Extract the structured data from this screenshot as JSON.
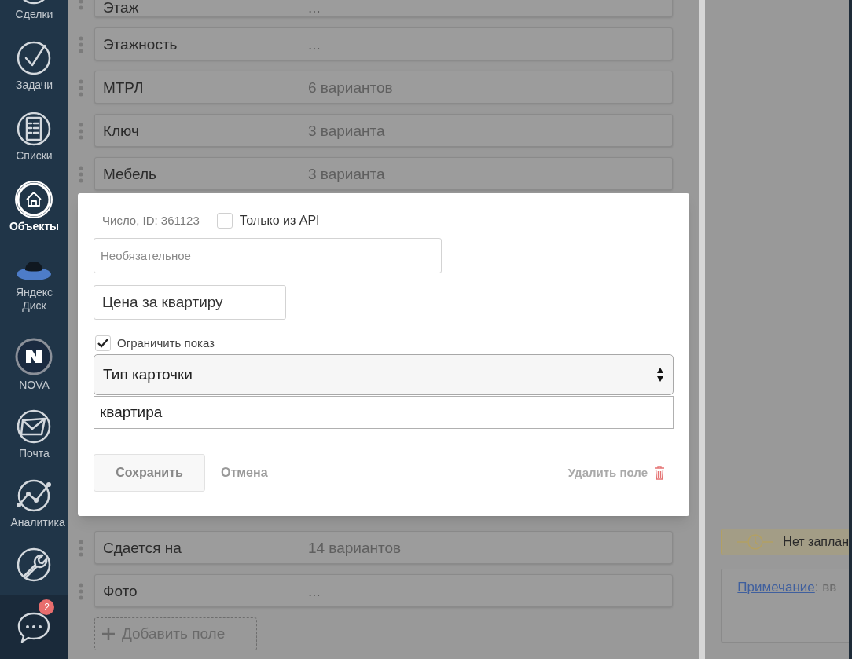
{
  "sidebar": {
    "items": [
      {
        "label": "Сделки",
        "selected": false
      },
      {
        "label": "Задачи",
        "selected": false
      },
      {
        "label": "Списки",
        "selected": false
      },
      {
        "label": "Объекты",
        "selected": true
      },
      {
        "label": "Яндекс Диск",
        "selected": false
      },
      {
        "label": "NOVA",
        "selected": false
      },
      {
        "label": "Почта",
        "selected": false
      },
      {
        "label": "Аналитика",
        "selected": false
      },
      {
        "selected": false
      }
    ],
    "chat": {
      "badge": "2"
    }
  },
  "fields_top": [
    {
      "name": "Этаж",
      "value": "..."
    },
    {
      "name": "Этажность",
      "value": "..."
    },
    {
      "name": "МТРЛ",
      "value": "6 вариантов"
    },
    {
      "name": "Ключ",
      "value": "3 варианта"
    },
    {
      "name": "Мебель",
      "value": "3 варианта"
    }
  ],
  "fields_bottom": [
    {
      "name": "Сдается на",
      "value": "14 вариантов"
    },
    {
      "name": "Фото",
      "value": "..."
    }
  ],
  "add_field": "Добавить поле",
  "dialog": {
    "type_label": "Число, ID: 361123",
    "api_only": {
      "label": "Только из API",
      "checked": false
    },
    "required": {
      "placeholder": "Необязательное"
    },
    "name": {
      "value": "Цена за квартиру"
    },
    "restrict": {
      "label": "Ограничить показ",
      "checked": true
    },
    "select": {
      "value": "Тип карточки"
    },
    "select_value": {
      "value": "квартира"
    },
    "save": "Сохранить",
    "cancel": "Отмена",
    "delete": "Удалить поле"
  },
  "right_panel": {
    "reminder": "Нет заплан",
    "note_link": "Примечание",
    "note_text": ": вв"
  }
}
